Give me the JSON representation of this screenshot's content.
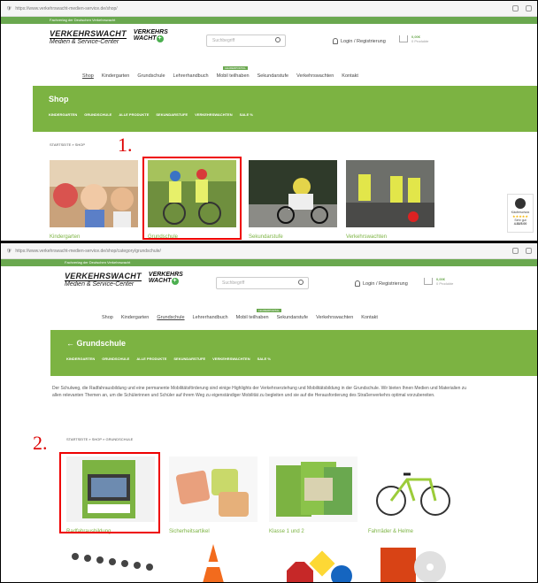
{
  "panel1": {
    "marker": "1.",
    "url": "https://www.verkehrswacht-medien-service.de/shop/",
    "topbar": "Fachverlag der Deutschen Verkehrswacht",
    "logo": {
      "line1": "VERKEHRSWACHT",
      "line2": "Medien & Service-Center",
      "wacht1": "VERKEHRS",
      "wacht2": "WACHT"
    },
    "search_placeholder": "Suchbegriff",
    "login": "Login / Registrierung",
    "cart": {
      "price": "0,00€",
      "items": "0 Produkte"
    },
    "nav": [
      "Shop",
      "Kindergarten",
      "Grundschule",
      "Lehrerhandbuch",
      "Mobil teilhaben",
      "Sekundarstufe",
      "Verkehrswachten",
      "Kontakt"
    ],
    "new_badge": "LEHRERPORTAL",
    "banner_title": "Shop",
    "subnav": [
      "KINDERGARTEN",
      "GRUNDSCHULE",
      "ALLE PRODUKTE",
      "SEKUNDARSTUFE",
      "VERKEHRSWACHTEN",
      "SALE %"
    ],
    "breadcrumb": "STARTSEITE » SHOP",
    "categories": [
      "Kindergarten",
      "Grundschule",
      "Sekundarstufe",
      "Verkehrswachten"
    ],
    "trust": {
      "title": "Käuferschutz",
      "stars": "★★★★★",
      "rating_label": "Sehr gut",
      "rating": "4.83/5.00"
    }
  },
  "panel2": {
    "marker": "2.",
    "url": "https://www.verkehrswacht-medien-service.de/shop/category/grundschule/",
    "topbar": "Fachverlag der Deutschen Verkehrswacht",
    "search_placeholder": "Suchbegriff",
    "login": "Login / Registrierung",
    "cart": {
      "price": "0,00€",
      "items": "0 Produkte"
    },
    "nav": [
      "Shop",
      "Kindergarten",
      "Grundschule",
      "Lehrerhandbuch",
      "Mobil teilhaben",
      "Sekundarstufe",
      "Verkehrswachten",
      "Kontakt"
    ],
    "new_badge": "LEHRERPORTAL",
    "banner_title": "← Grundschule",
    "subnav": [
      "KINDERGARTEN",
      "GRUNDSCHULE",
      "ALLE PRODUKTE",
      "SEKUNDARSTUFE",
      "VERKEHRSWACHTEN",
      "SALE %"
    ],
    "intro": "Der Schulweg, die Radfahrausbildung und eine permanente Mobilitätsförderung sind einige Highlights der Verkehrserziehung und Mobilitätsbildung in der Grundschule. Wir bieten Ihnen Medien und Materialien zu allen relevanten Themen an, um die Schülerinnen und Schüler auf ihrem Weg zu eigenständiger Mobilität zu begleiten und sie auf die Herausforderung des Straßenverkehrs optimal vorzubereiten.",
    "breadcrumb": "STARTSEITE » SHOP » GRUNDSCHULE",
    "categories": [
      "Radfahrausbildung",
      "Sicherheitsartikel",
      "Klasse 1 und 2",
      "Fahrräder & Helme"
    ]
  },
  "colors": {
    "brand_green": "#7cb342",
    "highlight_red": "#e00000"
  }
}
